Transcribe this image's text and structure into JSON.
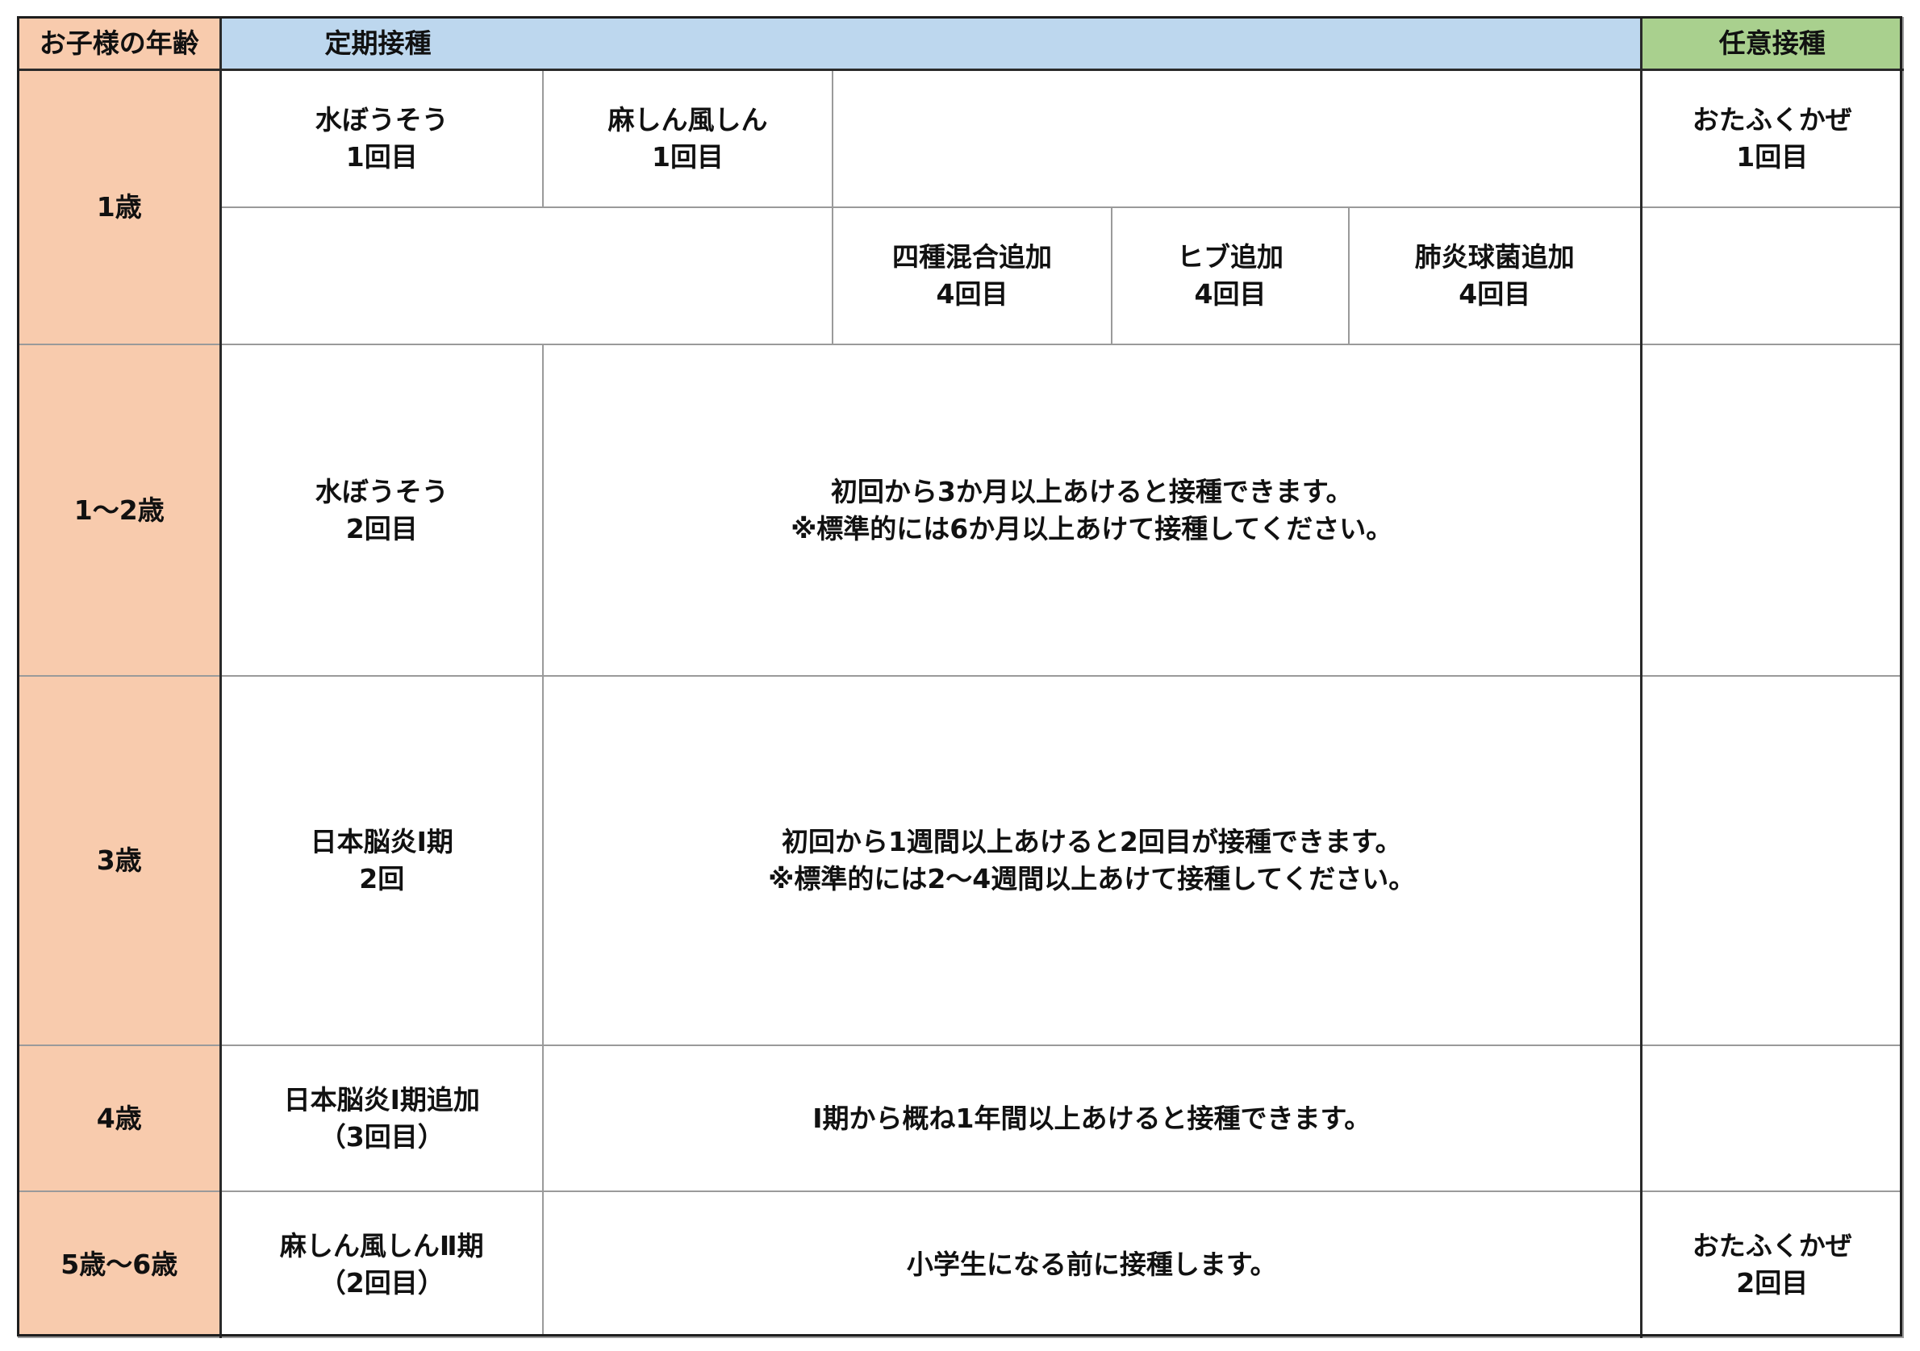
{
  "header": {
    "age": "お子様の年齢",
    "routine": "定期接種",
    "optional": "任意接種"
  },
  "row_1y": {
    "age": "1歳",
    "varicella": {
      "name": "水ぼうそう",
      "dose": "1回目"
    },
    "mr": {
      "name": "麻しん風しん",
      "dose": "1回目"
    },
    "mumps": {
      "name": "おたふくかぜ",
      "dose": "1回目"
    },
    "dtp": {
      "name": "四種混合追加",
      "dose": "4回目"
    },
    "hib": {
      "name": "ヒブ追加",
      "dose": "4回目"
    },
    "pcv": {
      "name": "肺炎球菌追加",
      "dose": "4回目"
    }
  },
  "row_1_2y": {
    "age": "1～2歳",
    "vaccine": {
      "name": "水ぼうそう",
      "dose": "2回目"
    },
    "note_line1": "初回から3か月以上あけると接種できます。",
    "note_line2": "※標準的には6か月以上あけて接種してください。"
  },
  "row_3y": {
    "age": "3歳",
    "vaccine": {
      "name": "日本脳炎Ⅰ期",
      "dose": "2回"
    },
    "note_line1": "初回から1週間以上あけると2回目が接種できます。",
    "note_line2": "※標準的には2～4週間以上あけて接種してください。"
  },
  "row_4y": {
    "age": "4歳",
    "vaccine": {
      "name": "日本脳炎Ⅰ期追加",
      "dose": "（3回目）"
    },
    "note": "Ⅰ期から概ね1年間以上あけると接種できます。"
  },
  "row_5_6y": {
    "age": "5歳～6歳",
    "vaccine": {
      "name": "麻しん風しんⅡ期",
      "dose": "（2回目）"
    },
    "note": "小学生になる前に接種します。",
    "optional": {
      "name": "おたふくかぜ",
      "dose": "2回目"
    }
  },
  "colors": {
    "age_column": "#f8cbad",
    "routine_header": "#bdd7ee",
    "optional_header": "#a9d08e"
  }
}
